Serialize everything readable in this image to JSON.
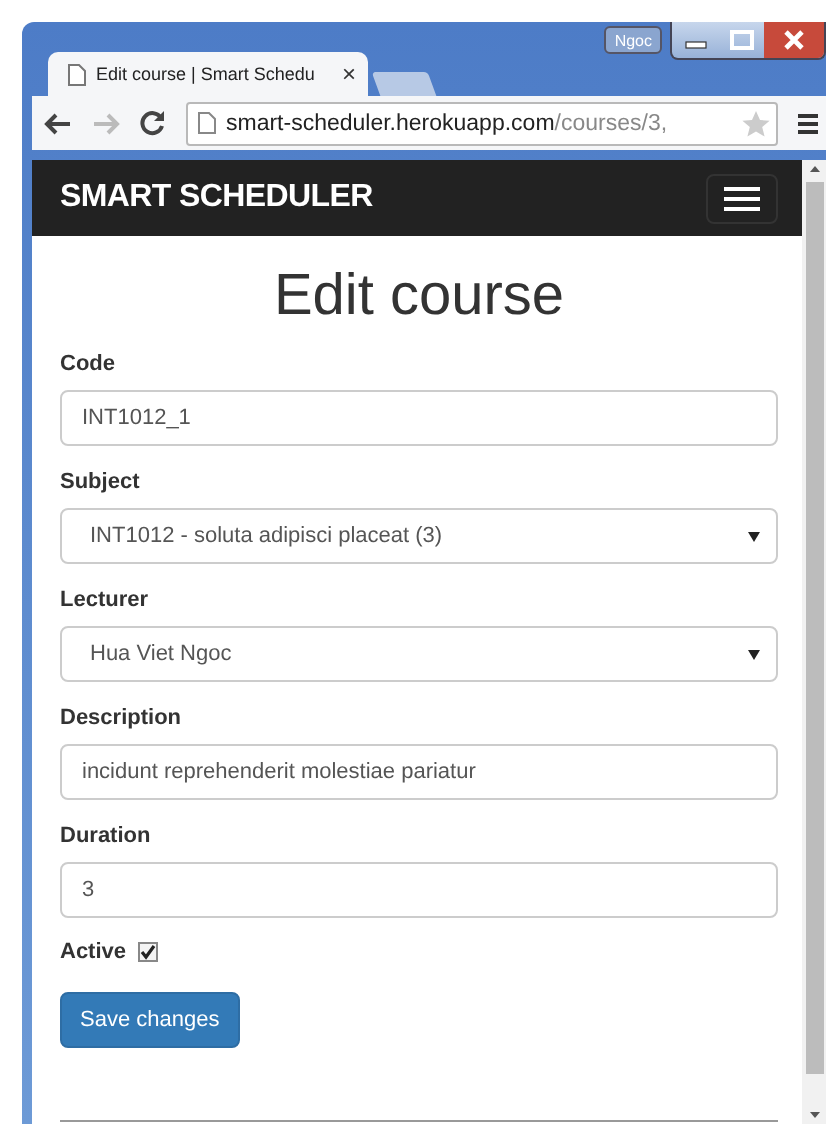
{
  "browser": {
    "profile": "Ngoc",
    "tab": {
      "title": "Edit course | Smart Schedu",
      "close": "×"
    },
    "url": {
      "host": "smart-scheduler.herokuapp.com",
      "path": "/courses/3,"
    }
  },
  "navbar": {
    "brand": "SMART SCHEDULER"
  },
  "title": "Edit course",
  "fields": [
    {
      "kind": "text",
      "label": "Code",
      "value": "INT1012_1"
    },
    {
      "kind": "select",
      "label": "Subject",
      "value": "INT1012 - soluta adipisci placeat (3)"
    },
    {
      "kind": "select",
      "label": "Lecturer",
      "value": "Hua Viet Ngoc"
    },
    {
      "kind": "text",
      "label": "Description",
      "value": "incidunt reprehenderit molestiae pariatur"
    },
    {
      "kind": "text",
      "label": "Duration",
      "value": "3"
    }
  ],
  "active": {
    "label": "Active",
    "checked": true
  },
  "save_button": "Save changes"
}
